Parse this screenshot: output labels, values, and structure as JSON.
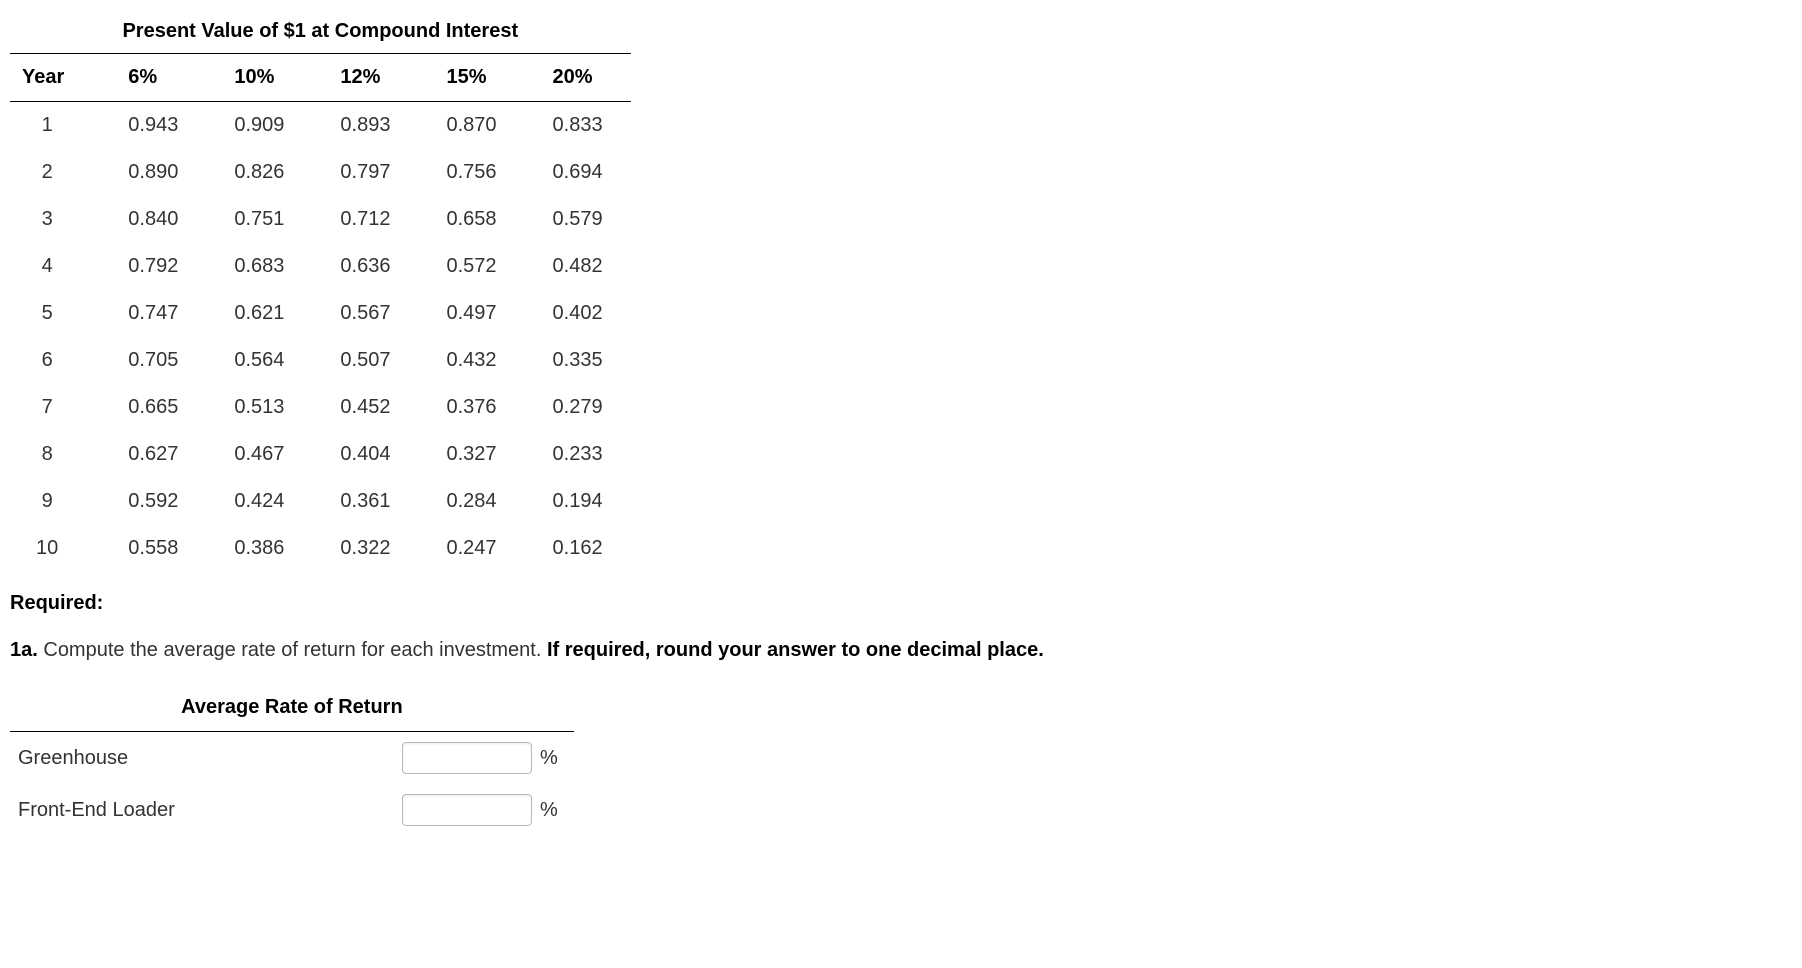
{
  "pv_table": {
    "caption": "Present Value of $1 at Compound Interest",
    "headers": [
      "Year",
      "6%",
      "10%",
      "12%",
      "15%",
      "20%"
    ],
    "rows": [
      [
        "1",
        "0.943",
        "0.909",
        "0.893",
        "0.870",
        "0.833"
      ],
      [
        "2",
        "0.890",
        "0.826",
        "0.797",
        "0.756",
        "0.694"
      ],
      [
        "3",
        "0.840",
        "0.751",
        "0.712",
        "0.658",
        "0.579"
      ],
      [
        "4",
        "0.792",
        "0.683",
        "0.636",
        "0.572",
        "0.482"
      ],
      [
        "5",
        "0.747",
        "0.621",
        "0.567",
        "0.497",
        "0.402"
      ],
      [
        "6",
        "0.705",
        "0.564",
        "0.507",
        "0.432",
        "0.335"
      ],
      [
        "7",
        "0.665",
        "0.513",
        "0.452",
        "0.376",
        "0.279"
      ],
      [
        "8",
        "0.627",
        "0.467",
        "0.404",
        "0.327",
        "0.233"
      ],
      [
        "9",
        "0.592",
        "0.424",
        "0.361",
        "0.284",
        "0.194"
      ],
      [
        "10",
        "0.558",
        "0.386",
        "0.322",
        "0.247",
        "0.162"
      ]
    ]
  },
  "required_label": "Required:",
  "question": {
    "number": "1a.",
    "text_1": "  Compute the average rate of return for each investment. ",
    "bold": "If required, round your answer to one decimal place."
  },
  "arr_table": {
    "caption": "Average Rate of Return",
    "rows": [
      {
        "label": "Greenhouse",
        "value": "",
        "suffix": "%"
      },
      {
        "label": "Front-End Loader",
        "value": "",
        "suffix": "%"
      }
    ]
  },
  "chart_data": {
    "type": "table",
    "title": "Present Value of $1 at Compound Interest",
    "columns": [
      "Year",
      "6%",
      "10%",
      "12%",
      "15%",
      "20%"
    ],
    "rows": [
      [
        1,
        0.943,
        0.909,
        0.893,
        0.87,
        0.833
      ],
      [
        2,
        0.89,
        0.826,
        0.797,
        0.756,
        0.694
      ],
      [
        3,
        0.84,
        0.751,
        0.712,
        0.658,
        0.579
      ],
      [
        4,
        0.792,
        0.683,
        0.636,
        0.572,
        0.482
      ],
      [
        5,
        0.747,
        0.621,
        0.567,
        0.497,
        0.402
      ],
      [
        6,
        0.705,
        0.564,
        0.507,
        0.432,
        0.335
      ],
      [
        7,
        0.665,
        0.513,
        0.452,
        0.376,
        0.279
      ],
      [
        8,
        0.627,
        0.467,
        0.404,
        0.327,
        0.233
      ],
      [
        9,
        0.592,
        0.424,
        0.361,
        0.284,
        0.194
      ],
      [
        10,
        0.558,
        0.386,
        0.322,
        0.247,
        0.162
      ]
    ]
  }
}
